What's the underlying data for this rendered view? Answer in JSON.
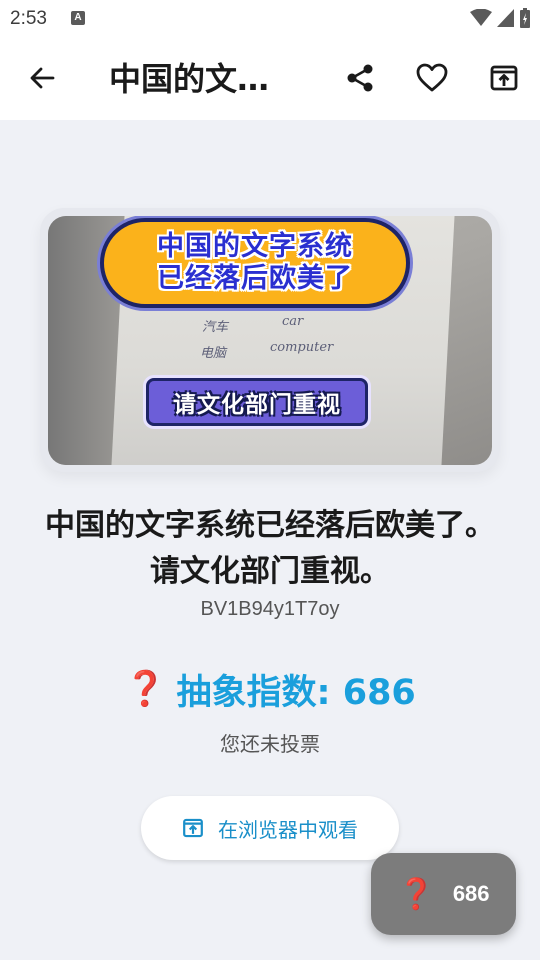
{
  "status_bar": {
    "time": "2:53",
    "app_icon_letter": "A"
  },
  "app_bar": {
    "title": "中国的文…",
    "icons": [
      "back-arrow-icon",
      "share-icon",
      "heart-icon",
      "open-external-icon"
    ]
  },
  "thumbnail": {
    "yellow_line_1": "中国的文字系统",
    "yellow_line_2": "已经落后欧美了",
    "purple_label": "请文化部门重视",
    "handwriting": [
      "汽车",
      "car",
      "电脑",
      "computer"
    ]
  },
  "video": {
    "title": "中国的文字系统已经落后欧美了。请文化部门重视。",
    "id": "BV1B94y1T7oy"
  },
  "index": {
    "icon": "❓",
    "label": "抽象指数: 686",
    "vote_status": "您还未投票"
  },
  "browser_button": {
    "label": "在浏览器中观看"
  },
  "fab": {
    "icon": "❓",
    "count": "686"
  },
  "colors": {
    "accent_blue": "#1a9fdc",
    "question_red": "#d8232a",
    "fab_gray": "#7c7c7c"
  }
}
